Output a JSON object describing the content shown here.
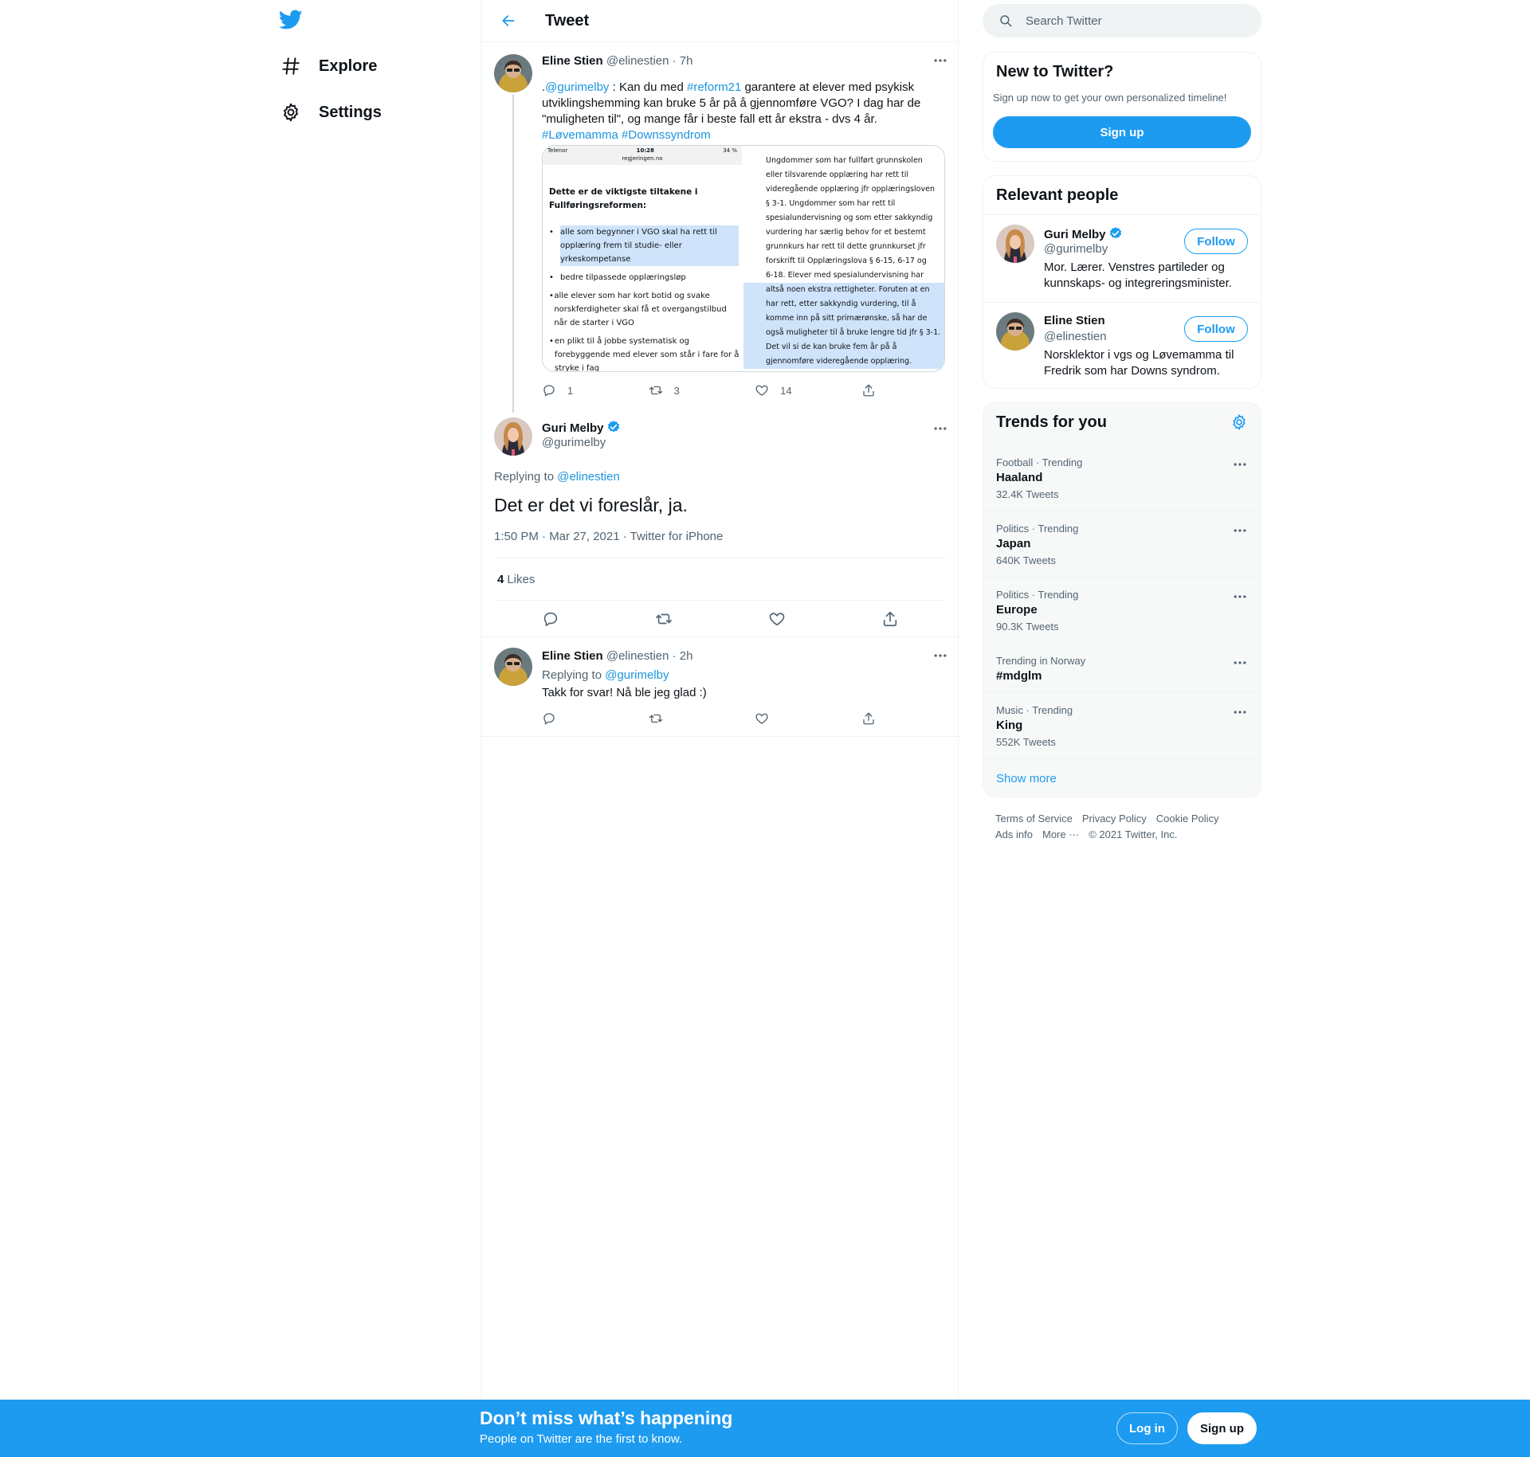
{
  "nav": {
    "logo": "twitter-bird-icon",
    "items": [
      {
        "label": "Explore",
        "icon": "hashtag-icon"
      },
      {
        "label": "Settings",
        "icon": "gear-icon"
      }
    ]
  },
  "header": {
    "title": "Tweet"
  },
  "tweet1": {
    "name": "Eline Stien",
    "handle": "@elinestien",
    "time": "· 7h",
    "text_parts": [
      ".",
      "@gurimelby",
      " : Kan du med ",
      "#reform21",
      " garantere at elever med psykisk utviklingshemming kan bruke 5 år på å gjennomføre VGO? I dag har de \"muligheten til\", og mange får i beste fall ett år ekstra - dvs 4 år. ",
      "#Løvemamma",
      " ",
      "#Downssyndrom"
    ],
    "media": {
      "status_carrier": "Telenor",
      "status_time": "10:28",
      "status_battery": "34 %",
      "url": "regjeringen.no",
      "left_heading": "Dette er de viktigste tiltakene i Fullføringsreformen:",
      "left_bullets": [
        "alle som begynner i VGO skal ha rett til opplæring frem til studie- eller yrkeskompetanse",
        "bedre tilpassede opplæringsløp",
        "alle elever som har kort botid og svake norskferdigheter skal få et overgangstilbud når de starter i VGO",
        "en plikt til å jobbe systematisk og forebyggende med elever som står i fare for å stryke i fag"
      ],
      "right_lines": [
        "Ungdommer som har fullført grunnskolen",
        "eller tilsvarende opplæring har rett til",
        "videregående opplæring jfr opplæringsloven",
        "§ 3-1. Ungdommer som har rett til",
        "spesialundervisning og som etter sakkyndig",
        "vurdering har særlig behov for et bestemt",
        "grunnkurs har rett til dette grunnkurset jfr",
        "forskrift til Opplæringslova § 6-15, 6-17 og",
        "6-18. Elever med spesialundervisning har",
        "altså noen ekstra rettigheter. Foruten at en",
        "har rett, etter sakkyndig vurdering, til å",
        "komme inn på sitt primærønske, så har de",
        "også muligheter til å bruke lengre tid jfr § 3-1.",
        "Det vil si de kan bruke fem år på å",
        "gjennomføre videregående opplæring."
      ]
    },
    "replies": "1",
    "retweets": "3",
    "likes": "14"
  },
  "main_tweet": {
    "name": "Guri Melby",
    "handle": "@gurimelby",
    "replying_prefix": "Replying to ",
    "replying_handle": "@elinestien",
    "text": "Det er det vi foreslår, ja.",
    "meta": "1:50 PM · Mar 27, 2021 · Twitter for iPhone",
    "likes_count": "4",
    "likes_label": "Likes"
  },
  "reply_tweet": {
    "name": "Eline Stien",
    "handle": "@elinestien",
    "time": "· 2h",
    "replying_prefix": "Replying to ",
    "replying_handle": "@gurimelby",
    "text": "Takk for svar! Nå ble jeg glad :)"
  },
  "search": {
    "placeholder": "Search Twitter"
  },
  "new_to_twitter": {
    "title": "New to Twitter?",
    "subtitle": "Sign up now to get your own personalized timeline!",
    "button": "Sign up"
  },
  "relevant_people": {
    "title": "Relevant people",
    "people": [
      {
        "name": "Guri Melby",
        "handle": "@gurimelby",
        "bio": "Mor. Lærer. Venstres partileder og kunnskaps- og integreringsminister.",
        "follow": "Follow",
        "verified": true
      },
      {
        "name": "Eline Stien",
        "handle": "@elinestien",
        "bio": "Norsklektor i vgs og Løvemamma til Fredrik som har Downs syndrom.",
        "follow": "Follow",
        "verified": false
      }
    ]
  },
  "trends": {
    "title": "Trends for you",
    "items": [
      {
        "category": "Football · Trending",
        "name": "Haaland",
        "count": "32.4K Tweets"
      },
      {
        "category": "Politics · Trending",
        "name": "Japan",
        "count": "640K Tweets"
      },
      {
        "category": "Politics · Trending",
        "name": "Europe",
        "count": "90.3K Tweets"
      },
      {
        "category": "Trending in Norway",
        "name": "#mdglm",
        "count": ""
      },
      {
        "category": "Music · Trending",
        "name": "King",
        "count": "552K Tweets"
      }
    ],
    "show_more": "Show more"
  },
  "footer": {
    "links": [
      "Terms of Service",
      "Privacy Policy",
      "Cookie Policy",
      "Ads info",
      "More ···"
    ],
    "copyright": "© 2021 Twitter, Inc."
  },
  "bottom_bar": {
    "title": "Don’t miss what’s happening",
    "subtitle": "People on Twitter are the first to know.",
    "login": "Log in",
    "signup": "Sign up"
  },
  "colors": {
    "accent": "#1d9bf0",
    "text": "#0f1419",
    "muted": "#536471",
    "border": "#eff3f4"
  }
}
